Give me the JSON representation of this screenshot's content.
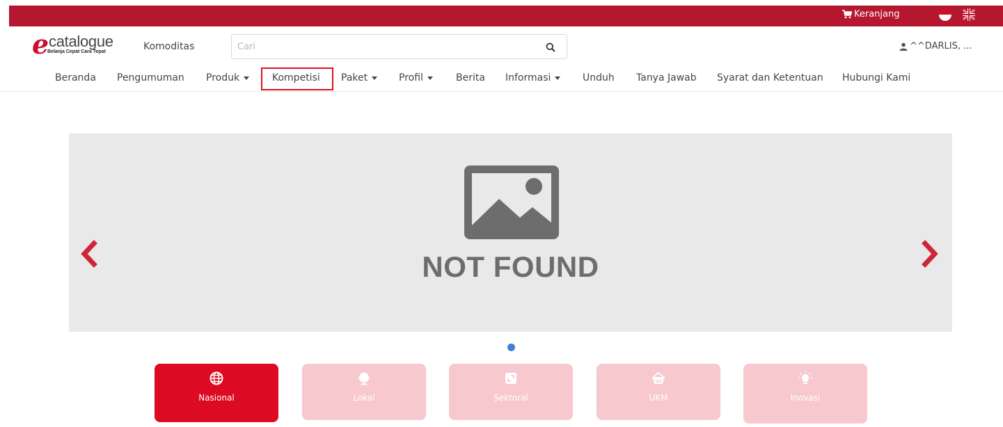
{
  "topbar": {
    "cart_label": "Keranjang",
    "languages": [
      "Indonesia",
      "English"
    ]
  },
  "header": {
    "logo": {
      "word": "catalogue",
      "tagline": "Belanja Cepat Cara Tepat"
    },
    "komoditas_label": "Komoditas",
    "search": {
      "placeholder": "Cari",
      "value": ""
    },
    "user_label": "^^DARLIS, ..."
  },
  "nav": {
    "items": [
      {
        "label": "Beranda",
        "dropdown": false
      },
      {
        "label": "Pengumuman",
        "dropdown": false
      },
      {
        "label": "Produk",
        "dropdown": true
      },
      {
        "label": "Kompetisi",
        "dropdown": false,
        "highlighted": true
      },
      {
        "label": "Paket",
        "dropdown": true
      },
      {
        "label": "Profil",
        "dropdown": true
      },
      {
        "label": "Berita",
        "dropdown": false
      },
      {
        "label": "Informasi",
        "dropdown": true
      },
      {
        "label": "Unduh",
        "dropdown": false
      },
      {
        "label": "Tanya Jawab",
        "dropdown": false
      },
      {
        "label": "Syarat dan Ketentuan",
        "dropdown": false
      },
      {
        "label": "Hubungi Kami",
        "dropdown": false
      }
    ]
  },
  "slider": {
    "image_text": "NOT FOUND",
    "slide_count": 1,
    "active_slide": 1
  },
  "categories": [
    {
      "label": "Nasional",
      "icon": "globe-icon",
      "active": true
    },
    {
      "label": "Lokal",
      "icon": "desk-globe-icon",
      "active": false
    },
    {
      "label": "Sektoral",
      "icon": "expand-icon",
      "active": false
    },
    {
      "label": "UKM",
      "icon": "basket-icon",
      "active": false
    },
    {
      "label": "Inovasi",
      "icon": "lightbulb-icon",
      "active": false
    }
  ],
  "colors": {
    "brand_red": "#b5172f",
    "active_red": "#dc0a22",
    "inactive_pink": "#f7c8ce",
    "highlight_border": "#e0101c",
    "dot_blue": "#3a83d6"
  }
}
